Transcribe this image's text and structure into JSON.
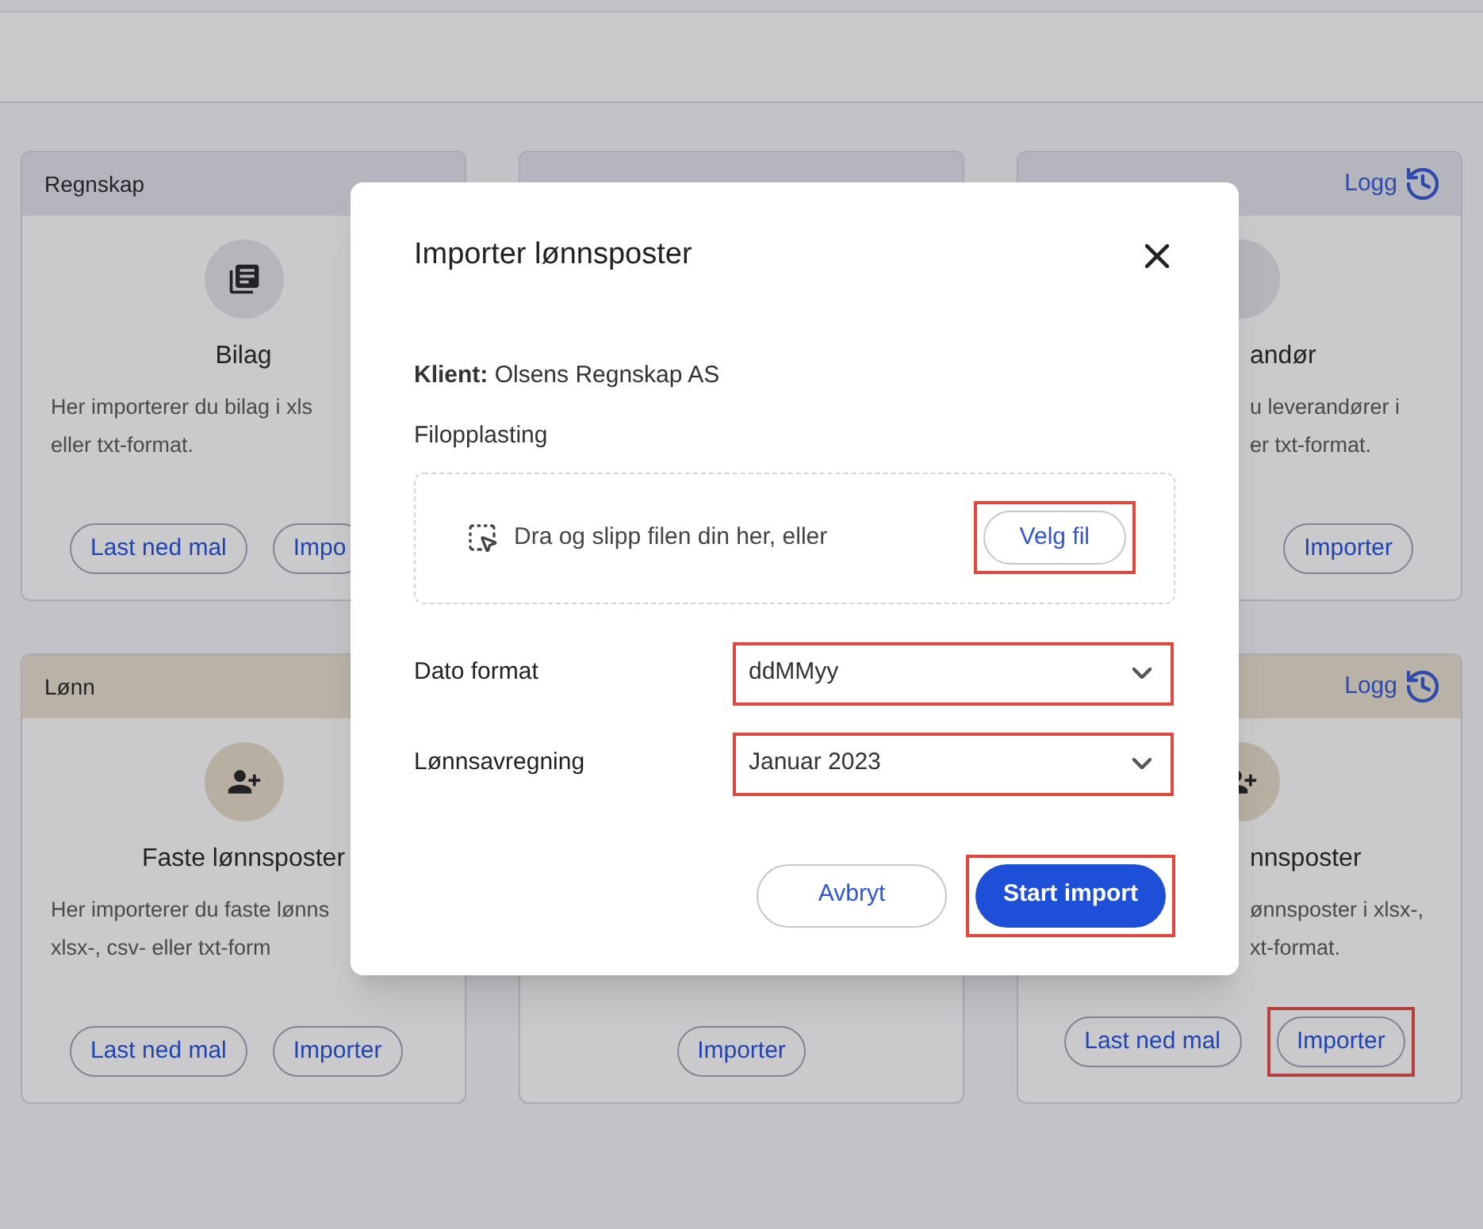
{
  "cards": [
    {
      "kind": "cut_right",
      "category": "Regnskap",
      "title": "Bilag",
      "description": [
        "Her importerer du bilag i xls",
        "eller txt-format."
      ],
      "buttons": [
        {
          "label": "Last ned mal",
          "highlighted": false
        },
        {
          "label": "Impo",
          "highlighted": false
        }
      ]
    },
    {
      "kind": "header_only"
    },
    {
      "kind": "cut_left",
      "log_link": "Logg",
      "title": "andør",
      "description": [
        "u leverandører i",
        "er txt-format."
      ],
      "buttons": [
        {
          "label": "Importer",
          "highlighted": false
        }
      ]
    },
    {
      "kind": "cut_right",
      "category": "Lønn",
      "title": "Faste lønnsposter",
      "description": [
        "Her importerer du faste lønns",
        "xlsx-, csv- eller txt-form"
      ],
      "buttons": [
        {
          "label": "Last ned mal",
          "highlighted": false
        },
        {
          "label": "Importer",
          "highlighted": false
        }
      ]
    },
    {
      "kind": "footer_only",
      "buttons": [
        {
          "label": "Importer",
          "highlighted": false
        }
      ]
    },
    {
      "kind": "cut_left",
      "log_link": "Logg",
      "title": "nnsposter",
      "description": [
        "ønnsposter i xlsx-,",
        "xt-format."
      ],
      "buttons": [
        {
          "label": "Last ned mal",
          "highlighted": false
        },
        {
          "label": "Importer",
          "highlighted": true
        }
      ]
    }
  ],
  "dialog": {
    "title": "Importer lønnsposter",
    "client": "**Klient:** Olsens Regnskap AS",
    "upload_label": "Filopplasting",
    "dropzone_text": "Dra og slipp filen din her, eller",
    "choose_file": {
      "label": "Velg fil",
      "highlighted": true
    },
    "fields": [
      {
        "label": "Dato format",
        "value": "ddMMyy",
        "highlighted": true
      },
      {
        "label": "Lønnsavregning",
        "value": "Januar 2023",
        "highlighted": true
      }
    ],
    "cancel": {
      "label": "Avbryt",
      "highlighted": false
    },
    "submit": {
      "label": "Start import",
      "highlighted": true
    }
  }
}
